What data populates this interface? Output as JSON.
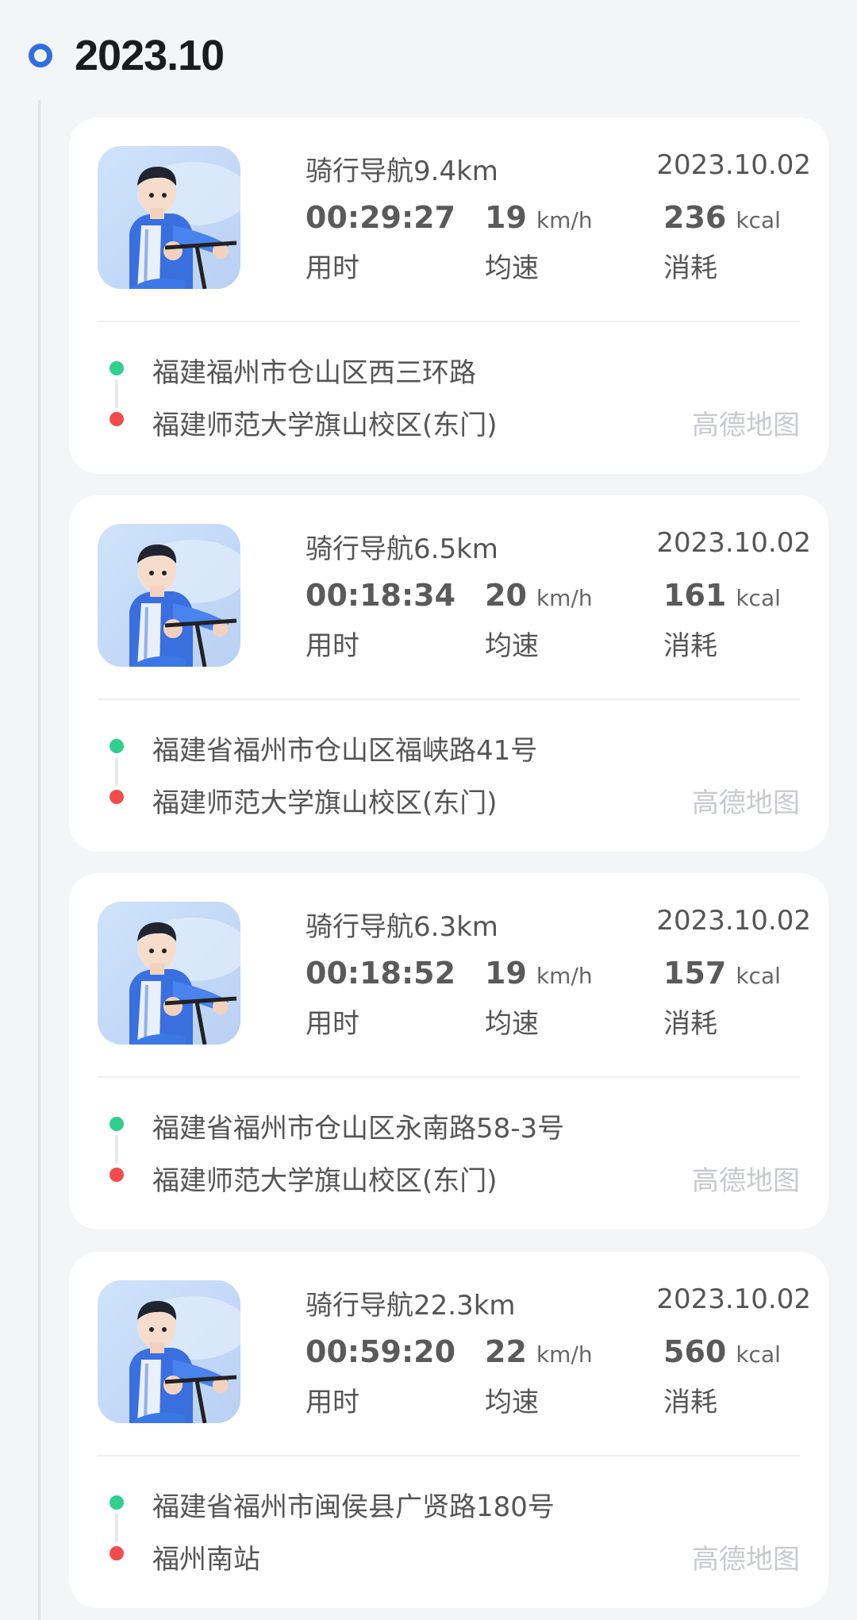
{
  "month": "2023.10",
  "labels": {
    "time": "用时",
    "speed": "均速",
    "calories": "消耗",
    "speed_unit": "km/h",
    "calorie_unit": "kcal",
    "map_link": "高德地图"
  },
  "colors": {
    "accent": "#2f6fe0",
    "start_dot": "#2ecf8f",
    "end_dot": "#f24b4b"
  },
  "icons": [
    "cyclist-avatar-icon"
  ],
  "records": [
    {
      "title": "骑行导航9.4km",
      "date": "2023.10.02",
      "duration": "00:29:27",
      "avg_speed": "19",
      "calories": "236",
      "start": "福建福州市仓山区西三环路",
      "end": "福建师范大学旗山校区(东门)"
    },
    {
      "title": "骑行导航6.5km",
      "date": "2023.10.02",
      "duration": "00:18:34",
      "avg_speed": "20",
      "calories": "161",
      "start": "福建省福州市仓山区福峡路41号",
      "end": "福建师范大学旗山校区(东门)"
    },
    {
      "title": "骑行导航6.3km",
      "date": "2023.10.02",
      "duration": "00:18:52",
      "avg_speed": "19",
      "calories": "157",
      "start": "福建省福州市仓山区永南路58-3号",
      "end": "福建师范大学旗山校区(东门)"
    },
    {
      "title": "骑行导航22.3km",
      "date": "2023.10.02",
      "duration": "00:59:20",
      "avg_speed": "22",
      "calories": "560",
      "start": "福建省福州市闽侯县广贤路180号",
      "end": "福州南站"
    }
  ]
}
